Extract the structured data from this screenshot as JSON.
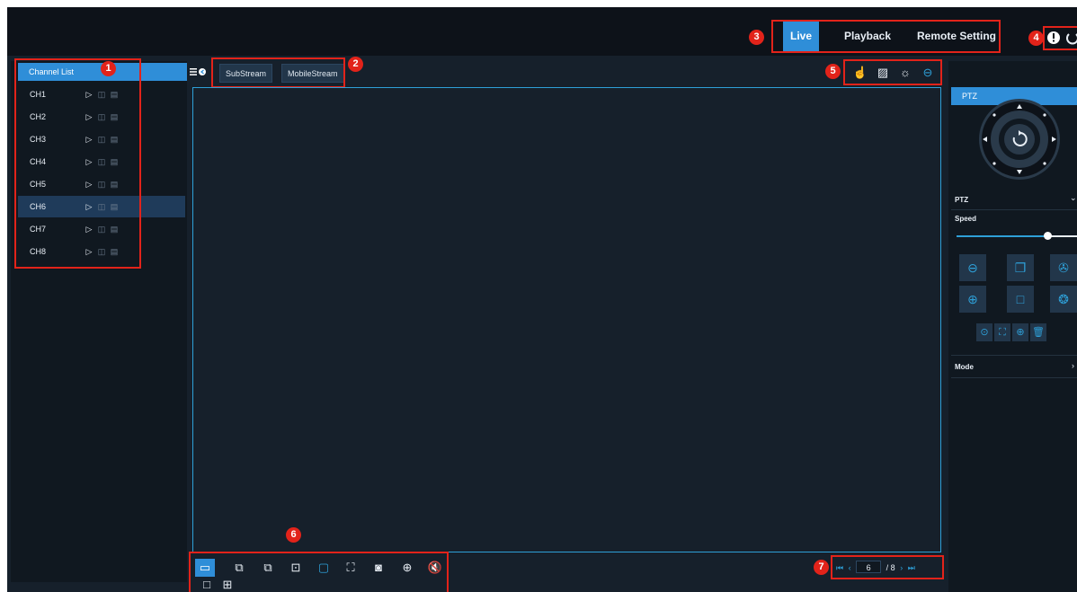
{
  "nav": {
    "tabs": [
      {
        "label": "Live",
        "active": true
      },
      {
        "label": "Playback",
        "active": false
      },
      {
        "label": "Remote Setting",
        "active": false
      }
    ],
    "icons": [
      "info-icon",
      "power-icon"
    ]
  },
  "callouts": [
    "1",
    "2",
    "3",
    "4",
    "5",
    "6",
    "7"
  ],
  "channel_list": {
    "title": "Channel List",
    "menu_icon": "list-menu-icon",
    "channels": [
      "CH1",
      "CH2",
      "CH3",
      "CH4",
      "CH5",
      "CH6",
      "CH7",
      "CH8"
    ],
    "selected": "CH6",
    "row_icons": [
      "play-icon",
      "snapshot-icon",
      "record-icon"
    ]
  },
  "streams": {
    "sub": "SubStream",
    "mobile": "MobileStream"
  },
  "video_top_icons": [
    "hand-icon",
    "image-settings-icon",
    "brightness-icon",
    "ptz-dome-icon"
  ],
  "toolbar": {
    "icons": [
      "single-view-icon",
      "previous-group-icon",
      "next-group-icon",
      "digital-zoom-icon",
      "screen-mode-icon",
      "fullscreen-icon",
      "snapshot-icon",
      "zoom-in-icon",
      "mute-icon"
    ],
    "layout_icons": [
      "single-layout-icon",
      "quad-layout-icon"
    ]
  },
  "pager": {
    "current": "6",
    "total_text": "/ 8",
    "icons": [
      "first-page-icon",
      "prev-page-icon",
      "next-page-icon",
      "last-page-icon"
    ]
  },
  "ptz": {
    "title": "PTZ",
    "section_ptz": "PTZ",
    "speed_label": "Speed",
    "speed_level": 0.75,
    "mode_label": "Mode",
    "colors": {
      "accent": "#2f8ed8",
      "highlight": "#e2231a"
    }
  }
}
